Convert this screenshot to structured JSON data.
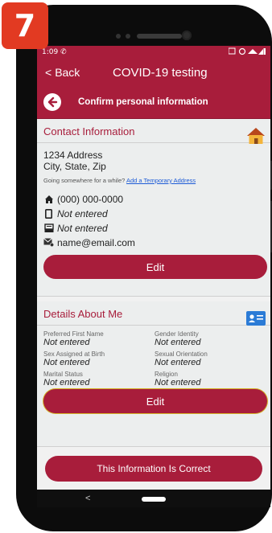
{
  "step_badge": "7",
  "status_bar": {
    "time": "1:09"
  },
  "nav": {
    "back_label": "Back",
    "title": "COVID-19 testing"
  },
  "subnav": {
    "label": "Confirm personal information"
  },
  "contact": {
    "title": "Contact Information",
    "address_line1": "1234 Address",
    "address_line2": "City, State, Zip",
    "note_text": "Going somewhere for a while?",
    "temp_address_link": "Add a Temporary Address",
    "phone_home": "(000) 000-0000",
    "phone_mobile": "Not entered",
    "fax": "Not entered",
    "email": "name@email.com",
    "edit_label": "Edit"
  },
  "details": {
    "title": "Details About Me",
    "fields": [
      {
        "label": "Preferred First Name",
        "value": "Not entered"
      },
      {
        "label": "Gender Identity",
        "value": "Not entered"
      },
      {
        "label": "Sex Assigned at Birth",
        "value": "Not entered"
      },
      {
        "label": "Sexual Orientation",
        "value": "Not entered"
      },
      {
        "label": "Marital Status",
        "value": "Not entered"
      },
      {
        "label": "Religion",
        "value": "Not entered"
      }
    ],
    "edit_label": "Edit"
  },
  "confirm_label": "This Information Is Correct",
  "colors": {
    "brand": "#a81d3b",
    "badge": "#e23a22",
    "link": "#1d5bd6"
  },
  "icons": [
    "back-arrow-icon",
    "home-icon",
    "mobile-phone-icon",
    "fax-icon",
    "email-icon",
    "id-card-icon",
    "house-illustration-icon"
  ]
}
